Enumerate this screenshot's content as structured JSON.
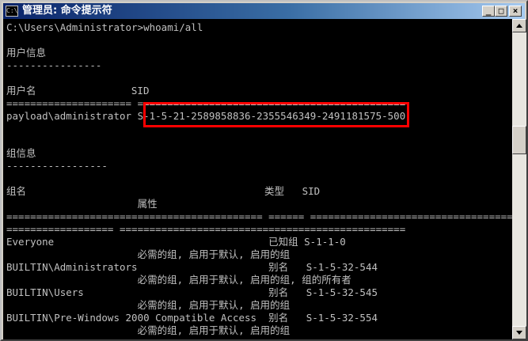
{
  "window": {
    "title": "管理员: 命令提示符",
    "icon": "cmd-icon",
    "icon_text": "C:\\"
  },
  "controls": {
    "minimize": "_",
    "maximize": "□",
    "close": "×"
  },
  "console": {
    "lines": [
      "C:\\Users\\Administrator>whoami/all",
      "用户信息",
      "----------------",
      "用户名                SID",
      "===================== =============================================",
      "payload\\administrator S-1-5-21-2589858836-2355546349-2491181575-500",
      "组信息",
      "-----------------",
      "组名                                        类型   SID",
      "                      属性",
      "=========================================== ====== ===================================",
      "================== ================================================",
      "Everyone                                    已知组 S-1-1-0",
      "                      必需的组, 启用于默认, 启用的组",
      "BUILTIN\\Administrators                      别名   S-1-5-32-544",
      "                      必需的组, 启用于默认, 启用的组, 组的所有者",
      "BUILTIN\\Users                               别名   S-1-5-32-545",
      "                      必需的组, 启用于默认, 启用的组",
      "BUILTIN\\Pre-Windows 2000 Compatible Access  别名   S-1-5-32-554",
      "                      必需的组, 启用于默认, 启用的组"
    ]
  },
  "colors": {
    "console_bg": "#000000",
    "console_text": "#c0c0c0",
    "highlight": "#ff0000",
    "title_bar": "#0a246a"
  }
}
